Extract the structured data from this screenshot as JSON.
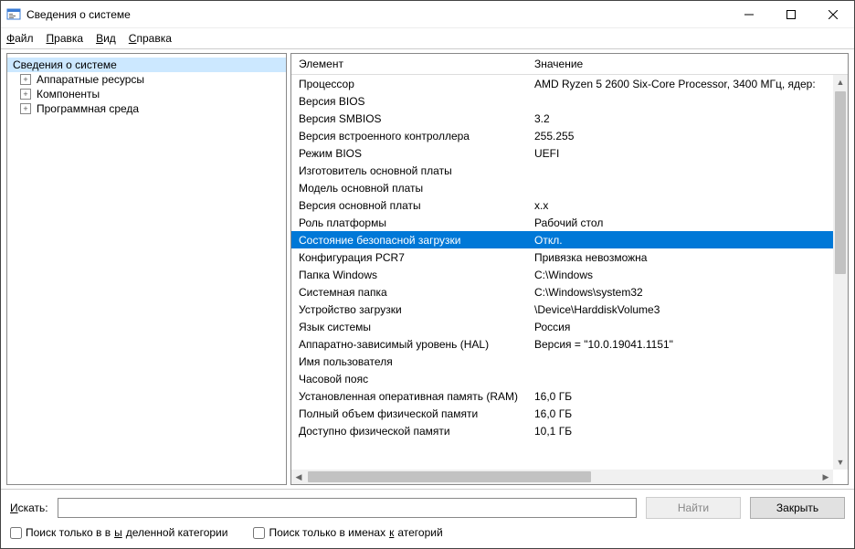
{
  "window": {
    "title": "Сведения о системе"
  },
  "menu": {
    "file": "Файл",
    "edit": "Правка",
    "view": "Вид",
    "help": "Справка"
  },
  "tree": {
    "root": "Сведения о системе",
    "items": [
      "Аппаратные ресурсы",
      "Компоненты",
      "Программная среда"
    ]
  },
  "list": {
    "col_element": "Элемент",
    "col_value": "Значение",
    "rows": [
      {
        "el": "Процессор",
        "val": "AMD Ryzen 5 2600 Six-Core Processor, 3400 МГц, ядер:"
      },
      {
        "el": "Версия BIOS",
        "val": ""
      },
      {
        "el": "Версия SMBIOS",
        "val": "3.2"
      },
      {
        "el": "Версия встроенного контроллера",
        "val": "255.255"
      },
      {
        "el": "Режим BIOS",
        "val": "UEFI"
      },
      {
        "el": "Изготовитель основной платы",
        "val": ""
      },
      {
        "el": "Модель основной платы",
        "val": ""
      },
      {
        "el": "Версия основной платы",
        "val": "x.x"
      },
      {
        "el": "Роль платформы",
        "val": "Рабочий стол"
      },
      {
        "el": "Состояние безопасной загрузки",
        "val": "Откл.",
        "selected": true
      },
      {
        "el": "Конфигурация PCR7",
        "val": "Привязка невозможна"
      },
      {
        "el": "Папка Windows",
        "val": "C:\\Windows"
      },
      {
        "el": "Системная папка",
        "val": "C:\\Windows\\system32"
      },
      {
        "el": "Устройство загрузки",
        "val": "\\Device\\HarddiskVolume3"
      },
      {
        "el": "Язык системы",
        "val": "Россия"
      },
      {
        "el": "Аппаратно-зависимый уровень (HAL)",
        "val": "Версия = \"10.0.19041.1151\""
      },
      {
        "el": "Имя пользователя",
        "val": ""
      },
      {
        "el": "Часовой пояс",
        "val": ""
      },
      {
        "el": "Установленная оперативная память (RAM)",
        "val": "16,0 ГБ"
      },
      {
        "el": "Полный объем физической памяти",
        "val": "16,0 ГБ"
      },
      {
        "el": "Доступно физической памяти",
        "val": "10,1 ГБ"
      }
    ]
  },
  "footer": {
    "search_label": "Искать:",
    "find_button": "Найти",
    "close_button": "Закрыть",
    "check_selected_category": "Поиск только в выделенной категории",
    "check_category_names": "Поиск только в именах категорий"
  }
}
